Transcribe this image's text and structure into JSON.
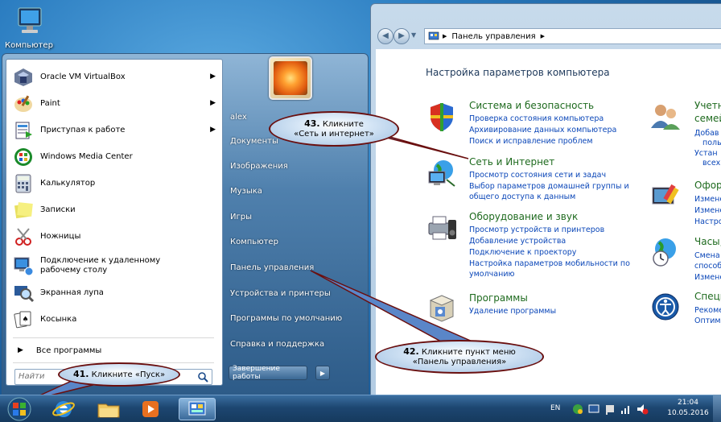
{
  "desktop": {
    "computer_label": "Компьютер"
  },
  "start_menu": {
    "programs": [
      {
        "label": "Oracle VM VirtualBox",
        "icon": "virtualbox-icon",
        "has_arrow": true
      },
      {
        "label": "Paint",
        "icon": "paint-icon",
        "has_arrow": true
      },
      {
        "label": "Приступая к работе",
        "icon": "getting-started-icon",
        "has_arrow": true
      },
      {
        "label": "Windows Media Center",
        "icon": "media-center-icon",
        "has_arrow": false
      },
      {
        "label": "Калькулятор",
        "icon": "calculator-icon",
        "has_arrow": false
      },
      {
        "label": "Записки",
        "icon": "sticky-notes-icon",
        "has_arrow": false
      },
      {
        "label": "Ножницы",
        "icon": "snipping-tool-icon",
        "has_arrow": false
      },
      {
        "label": "Подключение к удаленному рабочему столу",
        "icon": "remote-desktop-icon",
        "has_arrow": false
      },
      {
        "label": "Экранная лупа",
        "icon": "magnifier-icon",
        "has_arrow": false
      },
      {
        "label": "Косынка",
        "icon": "solitaire-icon",
        "has_arrow": false
      }
    ],
    "all_programs": "Все программы",
    "search_placeholder": "Найти",
    "right_items": [
      "alex",
      "Документы",
      "Изображения",
      "Музыка",
      "Игры",
      "Компьютер",
      "Панель управления",
      "Устройства и принтеры",
      "Программы по умолчанию",
      "Справка и поддержка"
    ],
    "shutdown_label": "Завершение работы"
  },
  "control_panel": {
    "breadcrumb": "Панель управления",
    "title": "Настройка параметров компьютера",
    "categories": [
      {
        "title": "Система и безопасность",
        "icon": "security-shield-icon",
        "links": [
          "Проверка состояния компьютера",
          "Архивирование данных компьютера",
          "Поиск и исправление проблем"
        ]
      },
      {
        "title": "Сеть и Интернет",
        "icon": "network-globe-icon",
        "links": [
          "Просмотр состояния сети и задач",
          "Выбор параметров домашней группы и",
          "общего доступа к данным"
        ]
      },
      {
        "title": "Оборудование и звук",
        "icon": "printer-speaker-icon",
        "links": [
          "Просмотр устройств и принтеров",
          "Добавление устройства",
          "Подключение к проектору",
          "Настройка параметров мобильности по",
          "умолчанию"
        ]
      },
      {
        "title": "Программы",
        "icon": "programs-box-icon",
        "links": [
          "Удаление программы"
        ]
      }
    ],
    "right_categories": [
      {
        "title": "Учетн",
        "title2": "семей",
        "icon": "users-icon",
        "links": [
          "Добав",
          "польз",
          "Устан",
          "всех"
        ]
      },
      {
        "title": "Офор",
        "icon": "appearance-icon",
        "links": [
          "Измене",
          "Измене",
          "Настро"
        ]
      },
      {
        "title": "Часы,",
        "icon": "clock-globe-icon",
        "links": [
          "Смена",
          "способ",
          "Измене"
        ]
      },
      {
        "title": "Специ",
        "icon": "ease-of-access-icon",
        "links": [
          "Рекоме",
          "Оптим"
        ]
      }
    ]
  },
  "callouts": {
    "c41": {
      "num": "41.",
      "text": "Кликните «Пуск»"
    },
    "c42": {
      "num": "42.",
      "text": "Кликните пункт меню",
      "text2": "«Панель управления»"
    },
    "c43": {
      "num": "43.",
      "text": "Кликните",
      "text2": "«Сеть и интернет»"
    }
  },
  "taskbar": {
    "lang": "EN",
    "time": "21:04",
    "date": "10.05.2016"
  },
  "colors": {
    "accent_link": "#0a46b8",
    "category_green": "#1e6a1e",
    "callout_border": "#6a0f0f"
  }
}
